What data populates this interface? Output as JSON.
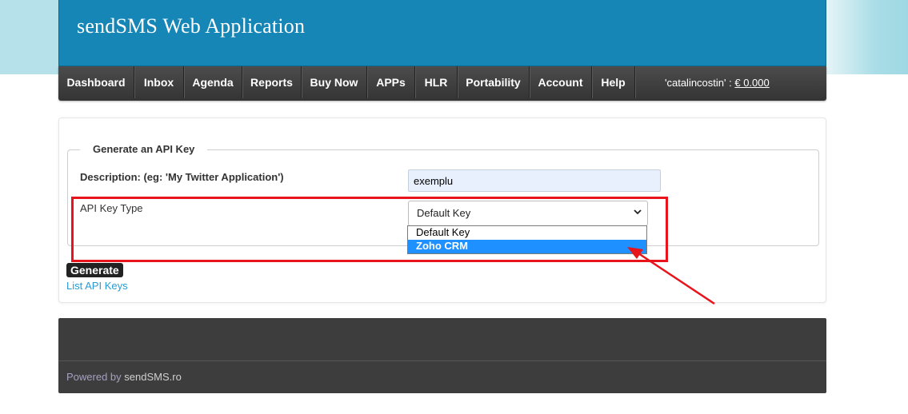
{
  "header": {
    "title": "sendSMS Web Application"
  },
  "nav": {
    "items": [
      {
        "label": "Dashboard"
      },
      {
        "label": "Inbox"
      },
      {
        "label": "Agenda"
      },
      {
        "label": "Reports"
      },
      {
        "label": "Buy Now"
      },
      {
        "label": "APPs"
      },
      {
        "label": "HLR"
      },
      {
        "label": "Portability"
      },
      {
        "label": "Account"
      },
      {
        "label": "Help"
      }
    ],
    "account": {
      "user": "'catalincostin' :",
      "balance": "€ 0.000"
    }
  },
  "form": {
    "legend": "Generate an API Key",
    "description_label": "Description: (eg: 'My Twitter Application')",
    "description_value": "exemplu",
    "type_label": "API Key Type",
    "type_selected": "Default Key",
    "type_options": [
      "Default Key",
      "Zoho CRM"
    ],
    "generate_label": "Generate",
    "list_link": "List API Keys"
  },
  "footer": {
    "powered_prefix": "Powered by",
    "powered_brand": "sendSMS.ro"
  },
  "colors": {
    "header_blue": "#1586b6",
    "nav_dark": "#3a3a3a",
    "highlight_red": "#e8141c",
    "selected_option": "#1e90ff",
    "link_blue": "#2a9bd3"
  }
}
